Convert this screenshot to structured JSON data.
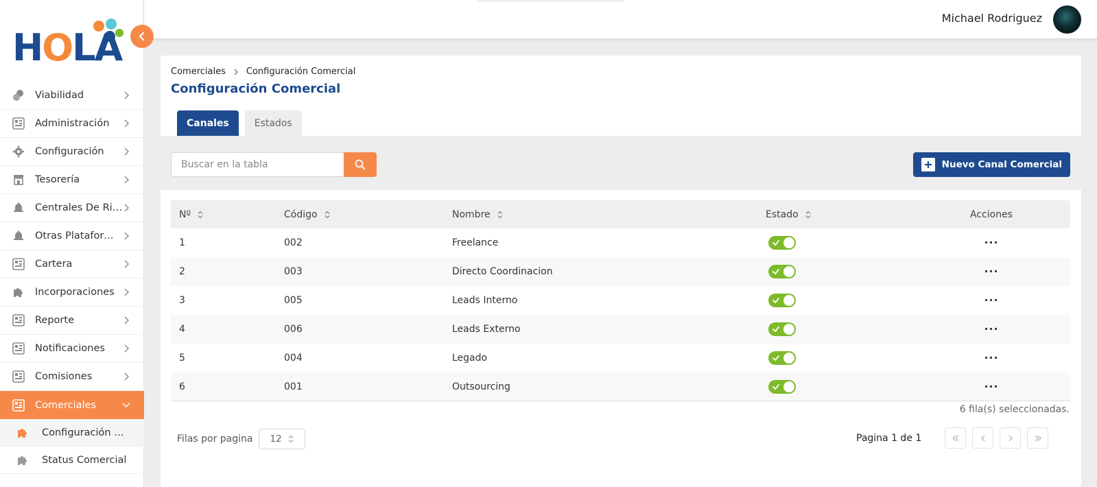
{
  "app": {
    "logo_text": "HOLA",
    "brand_colors": {
      "primary": "#1e4b8f",
      "accent": "#f6894a",
      "toggle_on": "#7dbb2a"
    }
  },
  "user": {
    "name": "Michael Rodriguez"
  },
  "sidebar": {
    "items": [
      {
        "label": "Viabilidad",
        "icon": "coins-icon"
      },
      {
        "label": "Administración",
        "icon": "grid-icon"
      },
      {
        "label": "Configuración",
        "icon": "gear-icon"
      },
      {
        "label": "Tesorería",
        "icon": "store-icon"
      },
      {
        "label": "Centrales De Riesgo",
        "icon": "bell-icon"
      },
      {
        "label": "Otras Plataformas",
        "icon": "bell-icon"
      },
      {
        "label": "Cartera",
        "icon": "grid-icon"
      },
      {
        "label": "Incorporaciones",
        "icon": "puzzle-icon"
      },
      {
        "label": "Reporte",
        "icon": "grid-icon"
      },
      {
        "label": "Notificaciones",
        "icon": "grid-icon"
      },
      {
        "label": "Comisiones",
        "icon": "grid-icon"
      },
      {
        "label": "Comerciales",
        "icon": "grid-icon",
        "active": true
      }
    ],
    "subitems": [
      {
        "label": "Configuración Comercial",
        "icon": "puzzle-icon",
        "current": true
      },
      {
        "label": "Status Comercial",
        "icon": "puzzle-icon"
      }
    ]
  },
  "breadcrumb": {
    "parent": "Comerciales",
    "current": "Configuración Comercial"
  },
  "page": {
    "title": "Configuración Comercial"
  },
  "tabs": [
    {
      "label": "Canales",
      "active": true
    },
    {
      "label": "Estados",
      "active": false
    }
  ],
  "search": {
    "placeholder": "Buscar en la tabla",
    "value": ""
  },
  "actions": {
    "new_label": "Nuevo Canal Comercial"
  },
  "table": {
    "columns": [
      "Nº",
      "Código",
      "Nombre",
      "Estado",
      "Acciones"
    ],
    "rows": [
      {
        "n": "1",
        "codigo": "002",
        "nombre": "Freelance",
        "estado": true,
        "acciones": "···"
      },
      {
        "n": "2",
        "codigo": "003",
        "nombre": "Directo Coordinacion",
        "estado": true,
        "acciones": "···"
      },
      {
        "n": "3",
        "codigo": "005",
        "nombre": "Leads Interno",
        "estado": true,
        "acciones": "···"
      },
      {
        "n": "4",
        "codigo": "006",
        "nombre": "Leads Externo",
        "estado": true,
        "acciones": "···"
      },
      {
        "n": "5",
        "codigo": "004",
        "nombre": "Legado",
        "estado": true,
        "acciones": "···"
      },
      {
        "n": "6",
        "codigo": "001",
        "nombre": "Outsourcing",
        "estado": true,
        "acciones": "···"
      }
    ]
  },
  "footer": {
    "selected_text": "6 fila(s) seleccionadas.",
    "rows_per_page_label": "Filas por pagina",
    "rows_per_page_value": "12",
    "page_info": "Pagina 1 de 1"
  }
}
